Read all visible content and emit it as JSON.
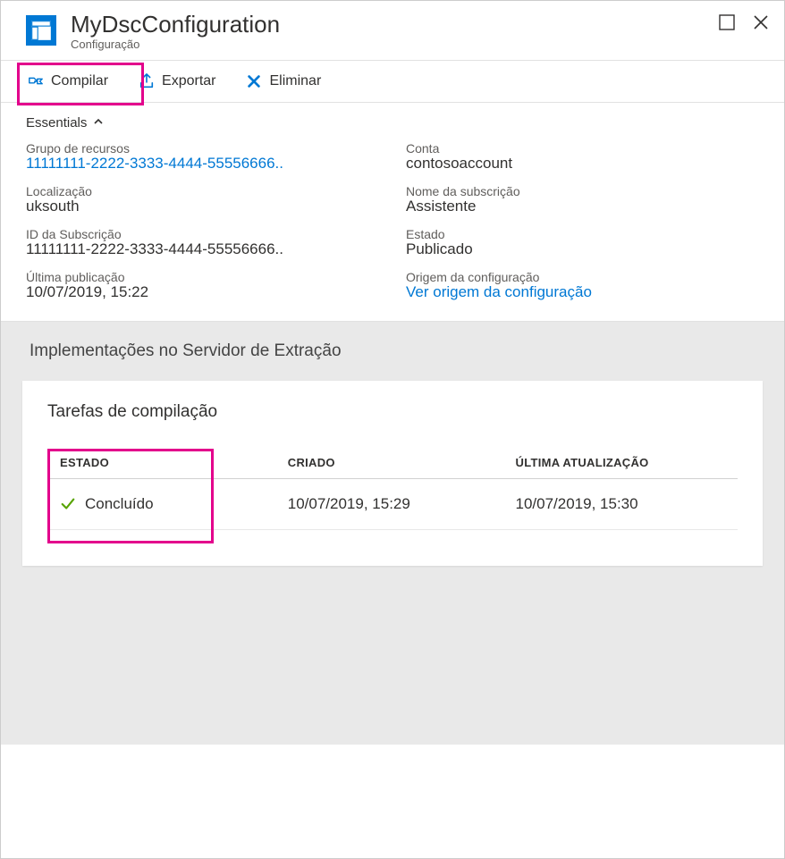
{
  "header": {
    "title": "MyDscConfiguration",
    "subtitle": "Configuração"
  },
  "toolbar": {
    "compile": "Compilar",
    "export": "Exportar",
    "delete": "Eliminar"
  },
  "essentials": {
    "title": "Essentials",
    "left": {
      "resource_group_label": "Grupo de recursos",
      "resource_group_value": "11111111-2222-3333-4444-55556666..",
      "location_label": "Localização",
      "location_value": "uksouth",
      "subscription_id_label": "ID da Subscrição",
      "subscription_id_value": "11111111-2222-3333-4444-55556666..",
      "last_published_label": "Última publicação",
      "last_published_value": "10/07/2019, 15:22"
    },
    "right": {
      "account_label": "Conta",
      "account_value": "contosoaccount",
      "subscription_name_label": "Nome da subscrição",
      "subscription_name_value": "Assistente",
      "status_label": "Estado",
      "status_value": "Publicado",
      "config_source_label": "Origem da configuração",
      "config_source_value": "Ver origem da configuração"
    }
  },
  "deployments": {
    "section_title": "Implementações no Servidor de Extração",
    "card_title": "Tarefas de compilação",
    "columns": {
      "status": "ESTADO",
      "created": "CRIADO",
      "updated": "ÚLTIMA ATUALIZAÇÃO"
    },
    "rows": [
      {
        "status": "Concluído",
        "created": "10/07/2019, 15:29",
        "updated": "10/07/2019, 15:30"
      }
    ]
  }
}
